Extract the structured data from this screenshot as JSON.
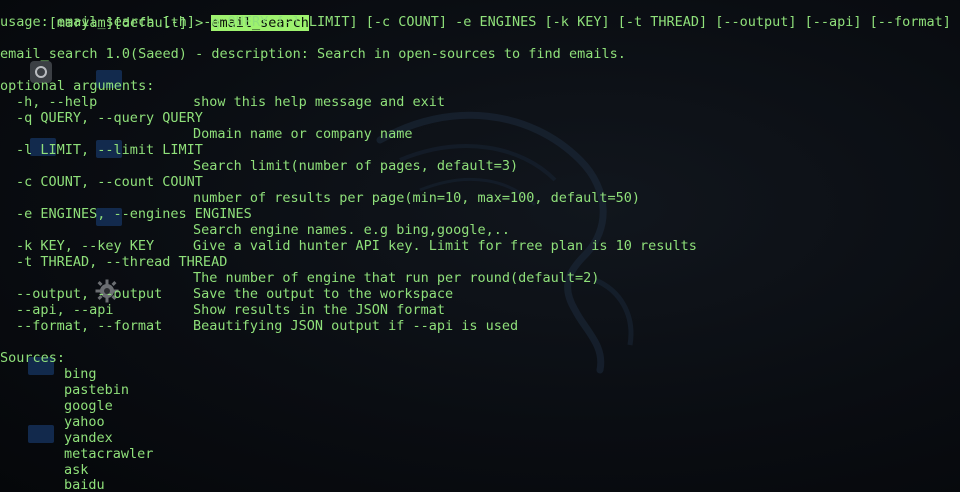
{
  "prompt": {
    "workspace": "[maryam][default]",
    "arrow": " > ",
    "command": "email_search"
  },
  "usage": "usage: email_search [-h] -q QUERY [-l LIMIT] [-c COUNT] -e ENGINES [-k KEY] [-t THREAD] [--output] [--api] [--format]",
  "description": "email_search 1.0(Saeed) - description: Search in open-sources to find emails.",
  "optional_header": "optional arguments:",
  "options": [
    {
      "flag": "-h, --help",
      "desc": "show this help message and exit"
    },
    {
      "flag": "-q QUERY, --query QUERY",
      "desc": "Domain name or company name"
    },
    {
      "flag": "-l LIMIT, --limit LIMIT",
      "desc": "Search limit(number of pages, default=3)"
    },
    {
      "flag": "-c COUNT, --count COUNT",
      "desc": "number of results per page(min=10, max=100, default=50)"
    },
    {
      "flag": "-e ENGINES, --engines ENGINES",
      "desc": "Search engine names. e.g bing,google,.."
    },
    {
      "flag": "-k KEY, --key KEY",
      "desc": "Give a valid hunter API key. Limit for free plan is 10 results"
    },
    {
      "flag": "-t THREAD, --thread THREAD",
      "desc": "The number of engine that run per round(default=2)"
    },
    {
      "flag": "--output, --output",
      "desc": "Save the output to the workspace"
    },
    {
      "flag": "--api, --api",
      "desc": "Show results in the JSON format"
    },
    {
      "flag": "--format, --format",
      "desc": "Beautifying JSON output if --api is used"
    }
  ],
  "sources_header": "Sources:",
  "sources": [
    "bing",
    "pastebin",
    "google",
    "yahoo",
    "yandex",
    "metacrawler",
    "ask",
    "baidu"
  ],
  "colors": {
    "text": "#8fe07a",
    "command_highlight": "#9ef26e",
    "background": "#07090d"
  }
}
